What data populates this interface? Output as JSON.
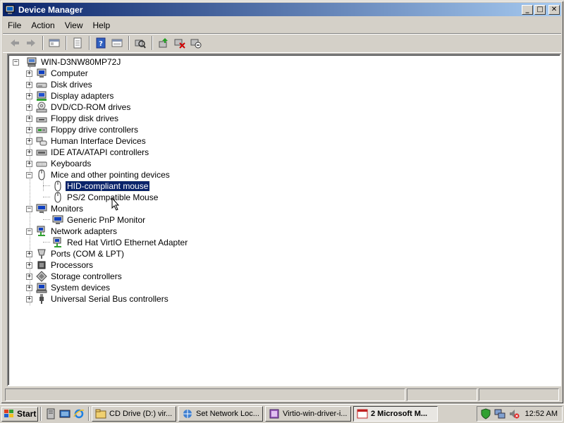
{
  "window": {
    "title": "Device Manager",
    "minimize": "_",
    "maximize": "□",
    "close": "✕"
  },
  "menu": [
    "File",
    "Action",
    "View",
    "Help"
  ],
  "toolbar": [
    "back-icon",
    "forward-icon",
    "up-icon",
    "properties-icon",
    "help-icon",
    "console-icon",
    "scan-hardware-icon",
    "update-driver-icon",
    "uninstall-icon",
    "disable-icon"
  ],
  "tree": {
    "root": "WIN-D3NW80MP72J",
    "items": [
      {
        "label": "Computer",
        "icon": "computer-icon",
        "expanded": false
      },
      {
        "label": "Disk drives",
        "icon": "disk-drive-icon",
        "expanded": false
      },
      {
        "label": "Display adapters",
        "icon": "display-adapter-icon",
        "expanded": false
      },
      {
        "label": "DVD/CD-ROM drives",
        "icon": "dvd-icon",
        "expanded": false
      },
      {
        "label": "Floppy disk drives",
        "icon": "floppy-icon",
        "expanded": false
      },
      {
        "label": "Floppy drive controllers",
        "icon": "floppy-controller-icon",
        "expanded": false
      },
      {
        "label": "Human Interface Devices",
        "icon": "hid-icon",
        "expanded": false
      },
      {
        "label": "IDE ATA/ATAPI controllers",
        "icon": "ide-icon",
        "expanded": false
      },
      {
        "label": "Keyboards",
        "icon": "keyboard-icon",
        "expanded": false
      },
      {
        "label": "Mice and other pointing devices",
        "icon": "mouse-icon",
        "expanded": true,
        "children": [
          {
            "label": "HID-compliant mouse",
            "icon": "mouse-icon",
            "selected": true
          },
          {
            "label": "PS/2 Compatible Mouse",
            "icon": "mouse-icon"
          }
        ]
      },
      {
        "label": "Monitors",
        "icon": "monitor-icon",
        "expanded": true,
        "children": [
          {
            "label": "Generic PnP Monitor",
            "icon": "monitor-icon"
          }
        ]
      },
      {
        "label": "Network adapters",
        "icon": "network-icon",
        "expanded": true,
        "children": [
          {
            "label": "Red Hat VirtIO Ethernet Adapter",
            "icon": "network-icon"
          }
        ]
      },
      {
        "label": "Ports (COM & LPT)",
        "icon": "port-icon",
        "expanded": false
      },
      {
        "label": "Processors",
        "icon": "processor-icon",
        "expanded": false
      },
      {
        "label": "Storage controllers",
        "icon": "storage-icon",
        "expanded": false
      },
      {
        "label": "System devices",
        "icon": "system-icon",
        "expanded": false
      },
      {
        "label": "Universal Serial Bus controllers",
        "icon": "usb-icon",
        "expanded": false
      }
    ]
  },
  "taskbar": {
    "start": "Start",
    "buttons": [
      {
        "label": "CD Drive (D:) vir...",
        "icon": "folder-icon"
      },
      {
        "label": "Set Network Loc...",
        "icon": "network-setup-icon"
      },
      {
        "label": "Virtio-win-driver-i...",
        "icon": "installer-icon"
      },
      {
        "label": "2 Microsoft M...",
        "icon": "mmc-icon",
        "active": true
      }
    ],
    "clock": "12:52 AM"
  },
  "colors": {
    "titlebar_start": "#0a246a",
    "titlebar_end": "#a6caf0",
    "selection": "#0a246a",
    "desktop": "#3a6ea5"
  }
}
